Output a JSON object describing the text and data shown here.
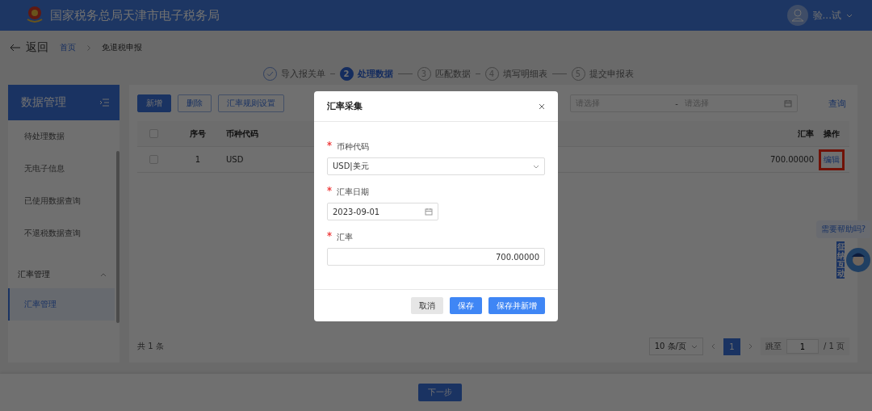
{
  "header": {
    "title": "国家税务总局天津市电子税务局",
    "user": "验...试"
  },
  "breadcrumb": {
    "back": "返回",
    "items": [
      "首页",
      "免退税申报"
    ]
  },
  "steps": [
    {
      "label": "导入报关单",
      "completed": true,
      "selected": false
    },
    {
      "number": "2",
      "label": "处理数据",
      "completed": false,
      "selected": true
    },
    {
      "number": "3",
      "label": "匹配数据",
      "completed": false,
      "selected": false
    },
    {
      "number": "4",
      "label": "填写明细表",
      "completed": false,
      "selected": false
    },
    {
      "number": "5",
      "label": "提交申报表",
      "completed": false,
      "selected": false
    }
  ],
  "sidebar": {
    "title": "数据管理",
    "items": [
      {
        "label": "待处理数据",
        "selected": false
      },
      {
        "label": "无电子信息",
        "selected": false
      },
      {
        "label": "已使用数据查询",
        "selected": false
      },
      {
        "label": "不退税数据查询",
        "selected": false
      }
    ],
    "groups": [
      {
        "label": "汇率管理",
        "expanded": true,
        "children": [
          {
            "label": "汇率管理",
            "selected": true
          }
        ]
      }
    ]
  },
  "toolbar": {
    "buttons": [
      {
        "label": "新增",
        "kind": "primary"
      },
      {
        "label": "删除",
        "kind": "default"
      },
      {
        "label": "汇率规则设置",
        "kind": "default"
      }
    ],
    "date_range": {
      "start_placeholder": "请选择",
      "separator": "-",
      "end_placeholder": "请选择"
    },
    "search": "查询"
  },
  "table": {
    "header_checked": false,
    "columns": [
      "序号",
      "币种代码",
      "汇率",
      "操作"
    ],
    "rows": [
      {
        "checked": false,
        "index": "1",
        "currency": "USD",
        "rate": "700.00000",
        "action": "编辑",
        "highlighted": true
      }
    ]
  },
  "pagination": {
    "total": "共 1 条",
    "page_size": "10 条/页",
    "pages": [
      {
        "label": "1",
        "selected": true
      }
    ],
    "jump_label": "跳至",
    "jump_value": "1",
    "total_pages": "/ 1 页"
  },
  "next_button": "下一步",
  "help": {
    "bubble": "需要帮助吗?",
    "badge": "征纳互动"
  },
  "dialog": {
    "title": "汇率采集",
    "fields": [
      {
        "kind": "select",
        "label": "币种代码",
        "required": true,
        "value": "USD|美元"
      },
      {
        "kind": "date",
        "label": "汇率日期",
        "required": true,
        "value": "2023-09-01"
      },
      {
        "kind": "number",
        "label": "汇率",
        "required": true,
        "value": "700.00000"
      }
    ],
    "buttons": [
      {
        "label": "取消",
        "kind": "default"
      },
      {
        "label": "保存",
        "kind": "primary"
      },
      {
        "label": "保存并新增",
        "kind": "primary"
      }
    ]
  }
}
